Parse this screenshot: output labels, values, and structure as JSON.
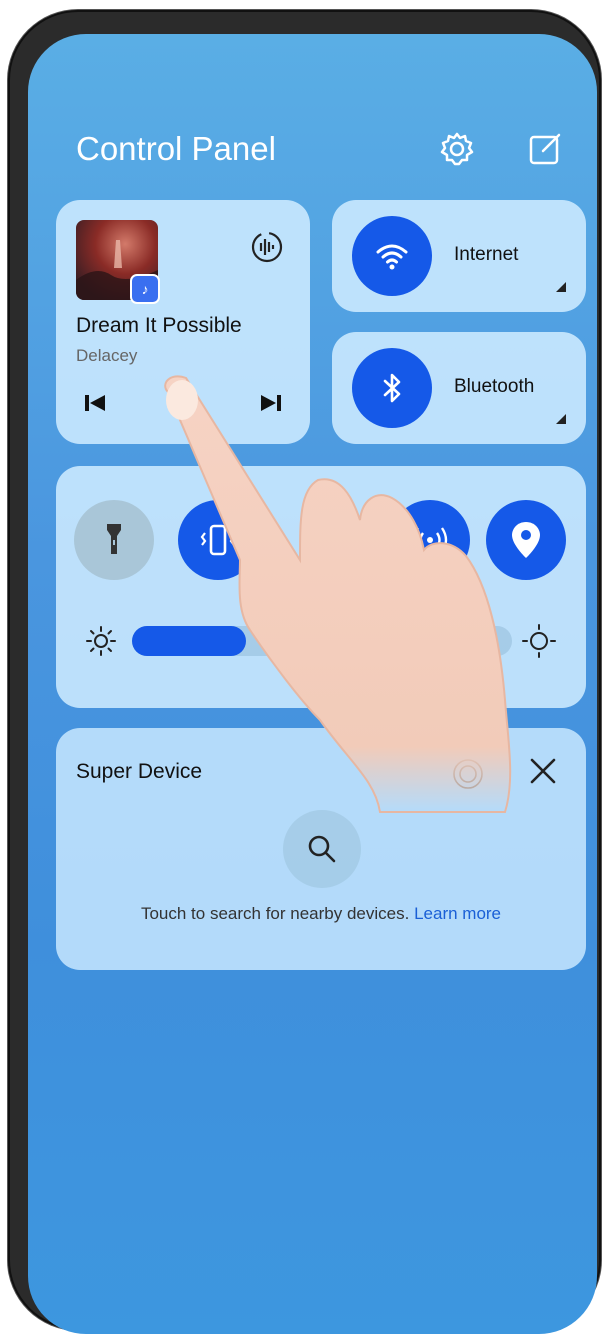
{
  "header": {
    "title": "Control Panel",
    "settings_icon": "gear-icon",
    "edit_icon": "edit-icon"
  },
  "media": {
    "song_title": "Dream It Possible",
    "artist": "Delacey",
    "app_badge_icon": "music-app-icon",
    "cast_icon": "audio-output-icon",
    "prev_icon": "previous-track-icon",
    "play_icon": "play-pause-icon",
    "next_icon": "next-track-icon"
  },
  "tiles": [
    {
      "label": "Internet",
      "icon": "wifi-icon",
      "active": true
    },
    {
      "label": "Bluetooth",
      "icon": "bluetooth-icon",
      "active": true
    }
  ],
  "toggles": [
    {
      "icon": "flashlight-icon",
      "active": false
    },
    {
      "icon": "vibrate-icon",
      "active": true
    },
    {
      "icon": "hotspot-icon",
      "active": true
    },
    {
      "icon": "location-icon",
      "active": true
    }
  ],
  "brightness": {
    "level": 0.3,
    "low_icon": "brightness-low-icon",
    "high_icon": "brightness-high-icon"
  },
  "super_device": {
    "title": "Super Device",
    "hint": "Touch to search for nearby devices.",
    "learn_more": "Learn more",
    "close_icon": "close-icon",
    "search_icon": "search-icon"
  },
  "colors": {
    "accent": "#1559e8",
    "panel_bg": "#4a96df",
    "link": "#1a5fd6"
  }
}
